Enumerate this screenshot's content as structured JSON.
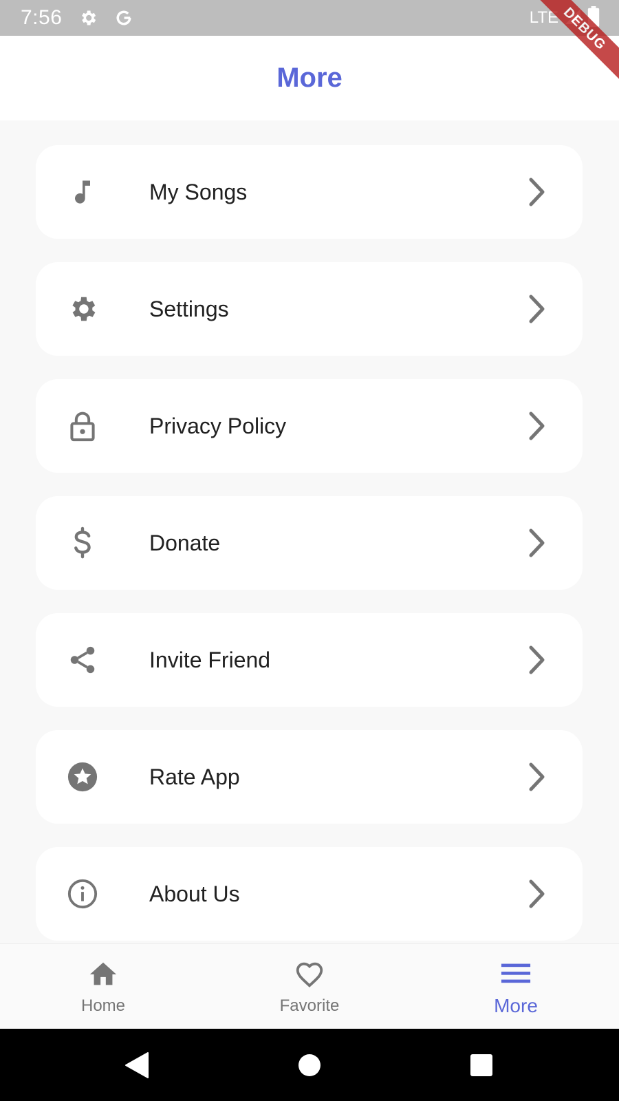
{
  "status_bar": {
    "time": "7:56",
    "network": "LTE",
    "debug_banner": "DEBUG",
    "icons": [
      "gear-icon",
      "google-g-icon",
      "signal-icon",
      "battery-icon"
    ]
  },
  "app_bar": {
    "title": "More"
  },
  "menu": {
    "items": [
      {
        "label": "My Songs",
        "icon": "music-note-icon"
      },
      {
        "label": "Settings",
        "icon": "gear-icon"
      },
      {
        "label": "Privacy Policy",
        "icon": "lock-icon"
      },
      {
        "label": "Donate",
        "icon": "dollar-icon"
      },
      {
        "label": "Invite Friend",
        "icon": "share-icon"
      },
      {
        "label": "Rate App",
        "icon": "star-icon"
      },
      {
        "label": "About Us",
        "icon": "info-icon"
      }
    ]
  },
  "bottom_nav": {
    "items": [
      {
        "label": "Home",
        "icon": "home-icon",
        "active": false
      },
      {
        "label": "Favorite",
        "icon": "heart-icon",
        "active": false
      },
      {
        "label": "More",
        "icon": "menu-icon",
        "active": true
      }
    ]
  },
  "colors": {
    "accent": "#5a67d8",
    "icon_gray": "#757575",
    "background": "#f8f8f8",
    "card": "#ffffff",
    "status_bar": "#bdbdbd",
    "debug_ribbon": "#b71c1c"
  }
}
